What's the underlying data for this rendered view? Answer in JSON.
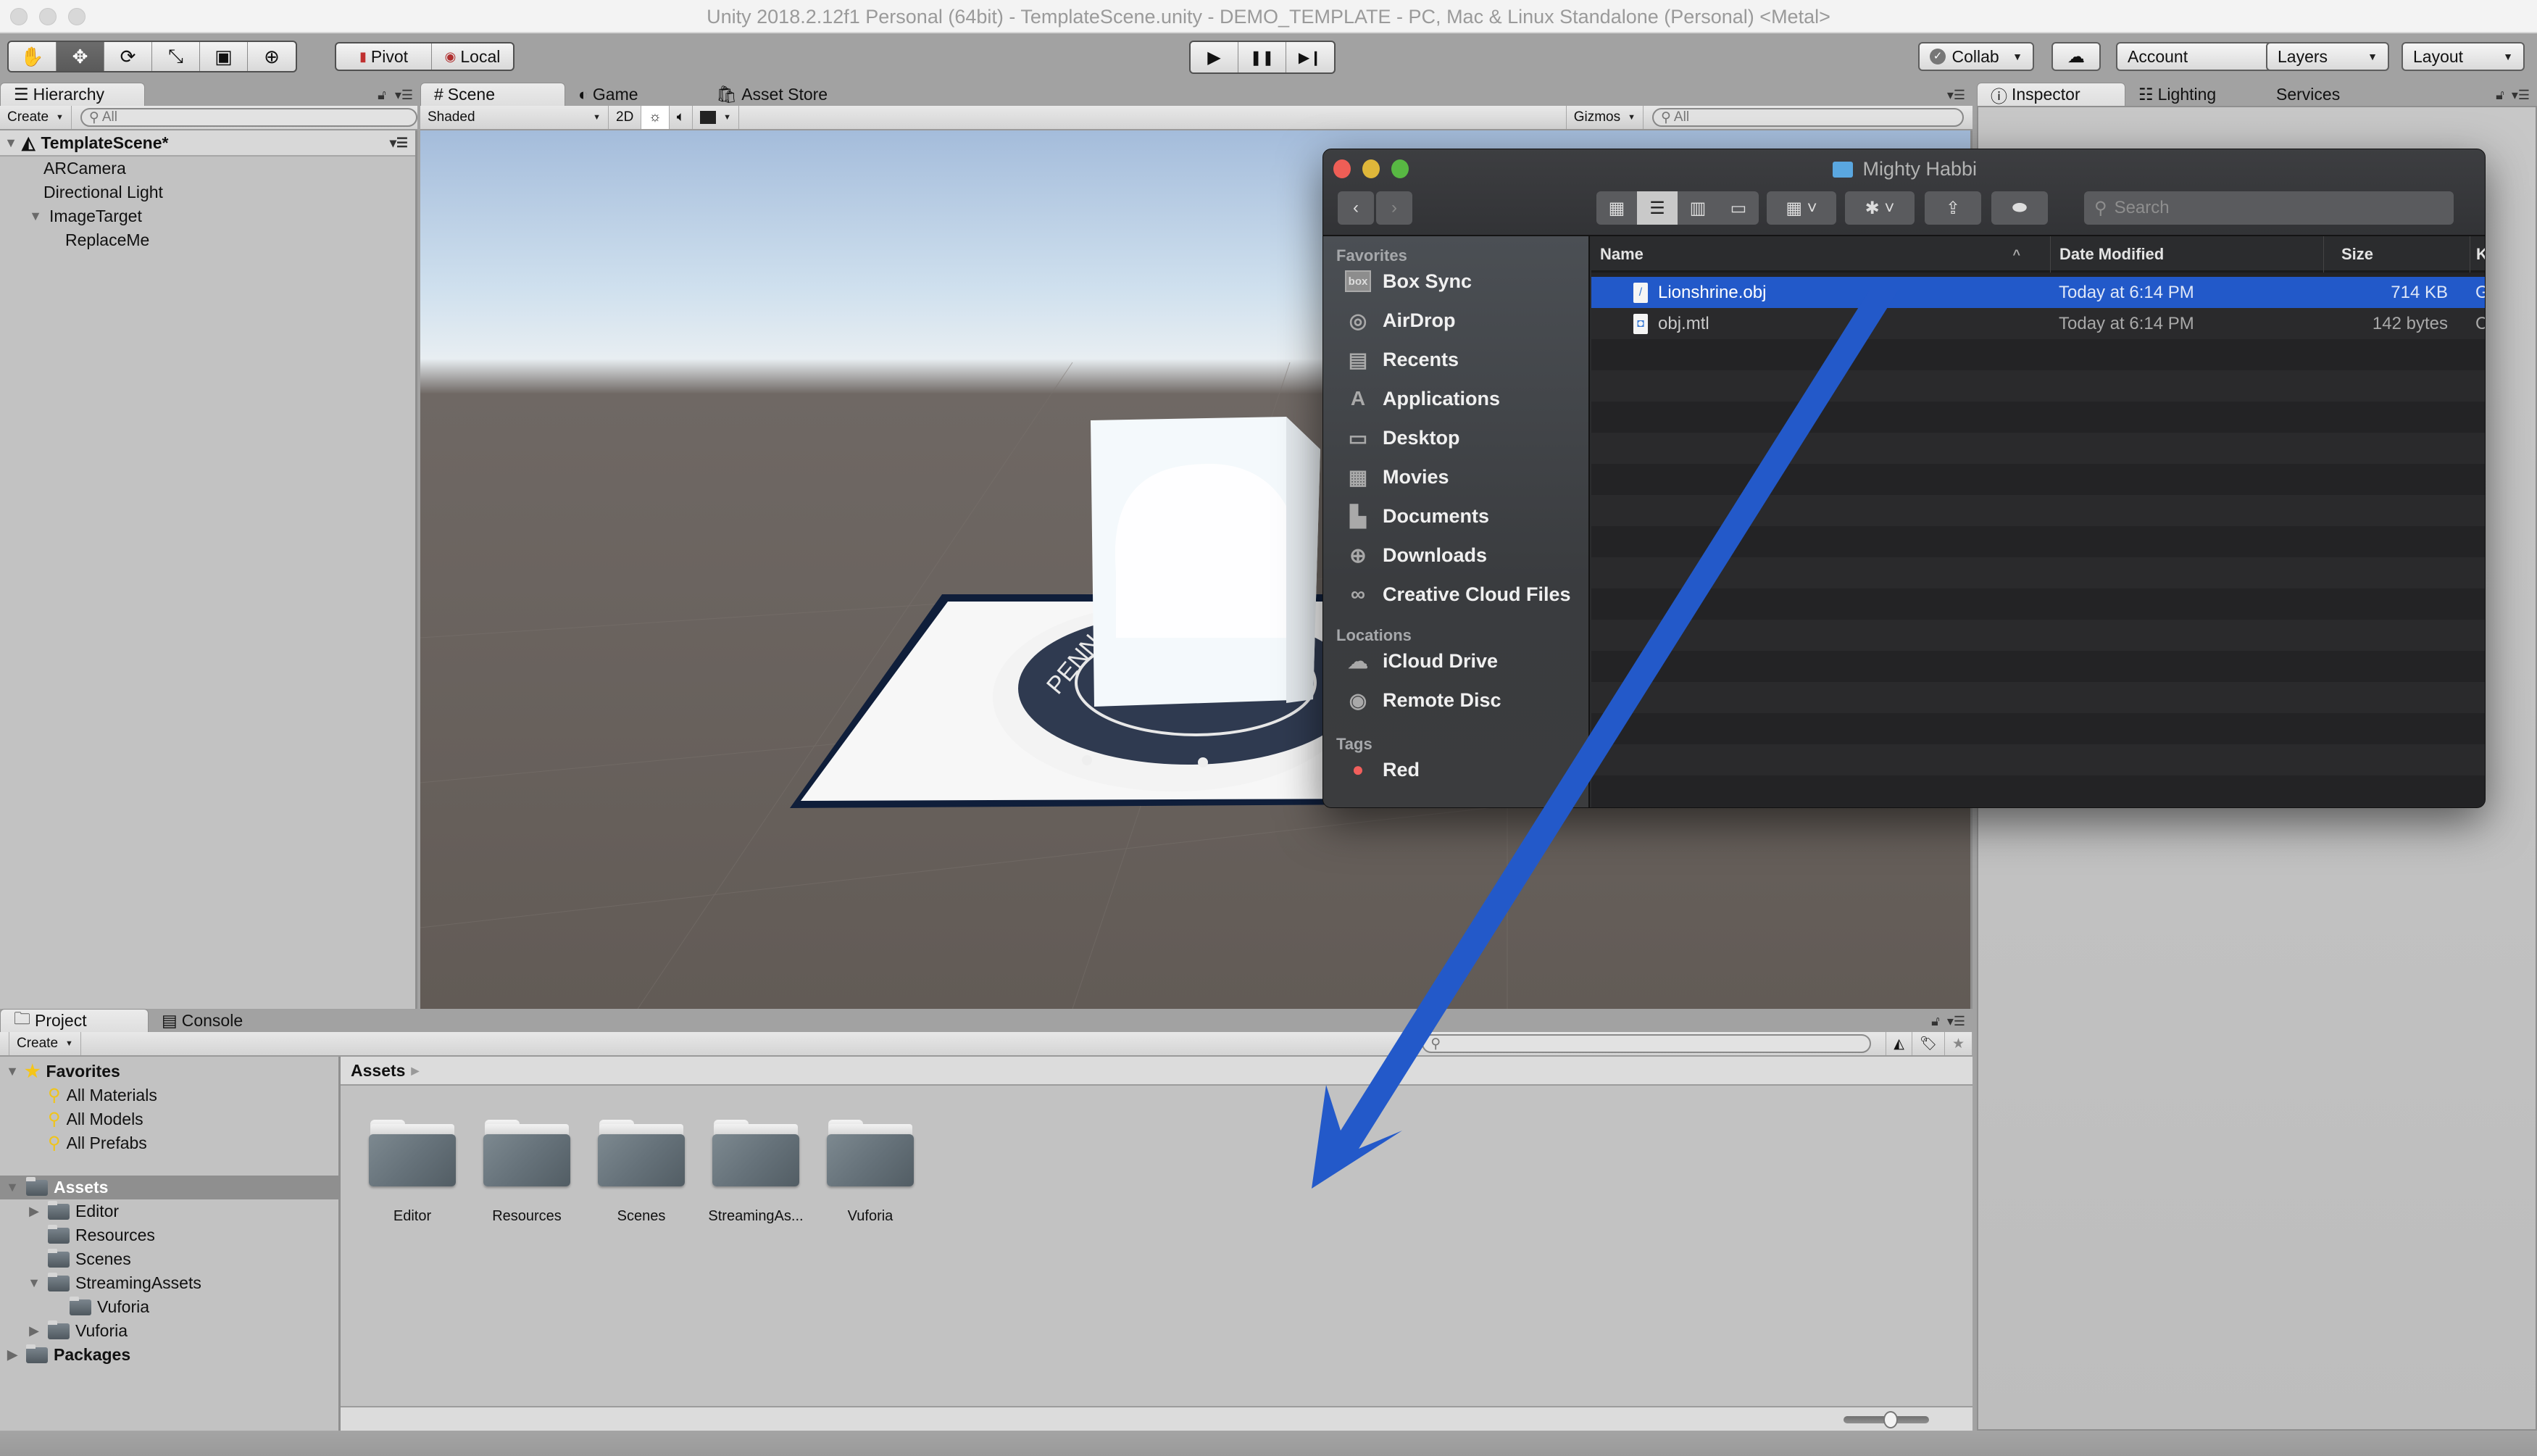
{
  "window": {
    "title": "Unity 2018.2.12f1 Personal (64bit) - TemplateScene.unity - DEMO_TEMPLATE - PC, Mac & Linux Standalone (Personal) <Metal>"
  },
  "toolbar": {
    "transform_tools": [
      {
        "name": "hand-tool",
        "glyph": "✋"
      },
      {
        "name": "move-tool",
        "glyph": "✥"
      },
      {
        "name": "rotate-tool",
        "glyph": "⟳"
      },
      {
        "name": "scale-tool",
        "glyph": "⤡"
      },
      {
        "name": "rect-tool",
        "glyph": "▣"
      },
      {
        "name": "transform-tool",
        "glyph": "⊕"
      }
    ],
    "active_tool": "move-tool",
    "pivot_label": "Pivot",
    "local_label": "Local",
    "play_glyph": "▶",
    "pause_glyph": "❚❚",
    "step_glyph": "▶❙",
    "collab_label": "Collab",
    "account_label": "Account",
    "layers_label": "Layers",
    "layout_label": "Layout"
  },
  "hierarchy": {
    "tab_label": "Hierarchy",
    "create_label": "Create",
    "search_placeholder": "All",
    "scene_name": "TemplateScene*",
    "items": [
      {
        "label": "ARCamera",
        "depth": 1,
        "expanded": null
      },
      {
        "label": "Directional Light",
        "depth": 1,
        "expanded": null
      },
      {
        "label": "ImageTarget",
        "depth": 1,
        "expanded": true
      },
      {
        "label": "ReplaceMe",
        "depth": 2,
        "expanded": null
      }
    ]
  },
  "scene": {
    "tabs": [
      {
        "label": "Scene",
        "icon": "#",
        "active": true
      },
      {
        "label": "Game",
        "icon": "◐",
        "active": false
      },
      {
        "label": "Asset Store",
        "icon": "🛍",
        "active": false
      }
    ],
    "shading_mode": "Shaded",
    "mode_2d_label": "2D",
    "gizmos_label": "Gizmos",
    "search_placeholder": "All",
    "seal_text": "PENN STATE"
  },
  "inspector": {
    "tabs": [
      {
        "label": "Inspector",
        "active": true
      },
      {
        "label": "Lighting",
        "active": false
      },
      {
        "label": "Services",
        "active": false
      }
    ]
  },
  "finder": {
    "title": "Mighty Habbi",
    "search_placeholder": "Search",
    "sidebar": {
      "favorites_header": "Favorites",
      "favorites": [
        {
          "label": "Box Sync",
          "icon": "box-icon"
        },
        {
          "label": "AirDrop",
          "icon": "airdrop-icon"
        },
        {
          "label": "Recents",
          "icon": "recents-icon"
        },
        {
          "label": "Applications",
          "icon": "applications-icon"
        },
        {
          "label": "Desktop",
          "icon": "desktop-icon"
        },
        {
          "label": "Movies",
          "icon": "movies-icon"
        },
        {
          "label": "Documents",
          "icon": "documents-icon"
        },
        {
          "label": "Downloads",
          "icon": "downloads-icon"
        },
        {
          "label": "Creative Cloud Files",
          "icon": "creative-cloud-icon"
        }
      ],
      "locations_header": "Locations",
      "locations": [
        {
          "label": "iCloud Drive",
          "icon": "icloud-icon"
        },
        {
          "label": "Remote Disc",
          "icon": "disc-icon"
        }
      ],
      "tags_header": "Tags",
      "tags": [
        {
          "label": "Red",
          "color": "#f25f5c"
        }
      ]
    },
    "columns": {
      "name": "Name",
      "date": "Date Modified",
      "size": "Size",
      "kind": "K"
    },
    "files": [
      {
        "name": "Lionshrine.obj",
        "date": "Today at 6:14 PM",
        "size": "714 KB",
        "kind": "G",
        "selected": true
      },
      {
        "name": "obj.mtl",
        "date": "Today at 6:14 PM",
        "size": "142 bytes",
        "kind": "C",
        "selected": false
      }
    ]
  },
  "project": {
    "tabs": [
      {
        "label": "Project",
        "active": true
      },
      {
        "label": "Console",
        "active": false
      }
    ],
    "create_label": "Create",
    "favorites": {
      "label": "Favorites",
      "items": [
        "All Materials",
        "All Models",
        "All Prefabs"
      ]
    },
    "tree": [
      {
        "label": "Assets",
        "depth": 0,
        "expanded": true,
        "selected": true,
        "bold": true
      },
      {
        "label": "Editor",
        "depth": 1,
        "expanded": false
      },
      {
        "label": "Resources",
        "depth": 1,
        "expanded": null
      },
      {
        "label": "Scenes",
        "depth": 1,
        "expanded": null
      },
      {
        "label": "StreamingAssets",
        "depth": 1,
        "expanded": true
      },
      {
        "label": "Vuforia",
        "depth": 2,
        "expanded": null
      },
      {
        "label": "Vuforia",
        "depth": 1,
        "expanded": false
      },
      {
        "label": "Packages",
        "depth": 0,
        "expanded": false,
        "bold": true
      }
    ],
    "breadcrumb": "Assets",
    "grid_items": [
      "Editor",
      "Resources",
      "Scenes",
      "StreamingAs...",
      "Vuforia"
    ],
    "icon_size_slider": 0.55
  },
  "annotation": {
    "arrow_color": "#2359c9",
    "meaning": "drag file from Finder into Project Assets"
  },
  "colors": {
    "finder_selection": "#2259c9",
    "unity_bg": "#a2a2a2",
    "panel_bg": "#c2c2c2"
  }
}
